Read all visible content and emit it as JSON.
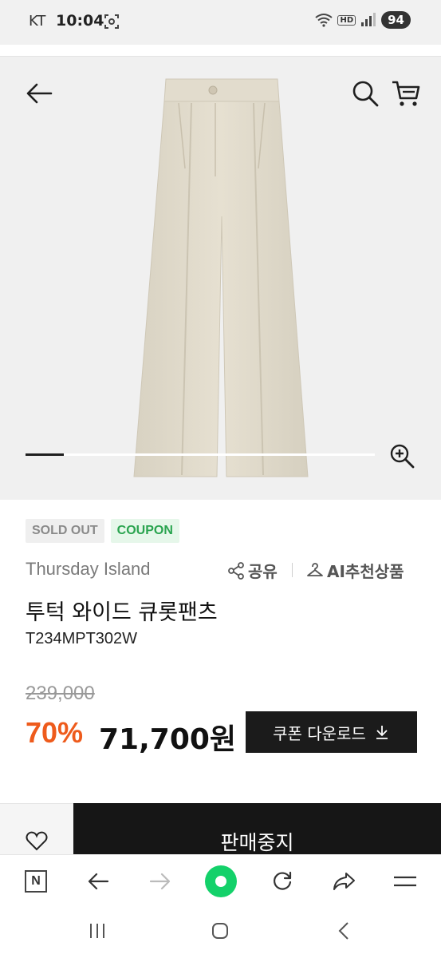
{
  "status_bar": {
    "carrier": "KT",
    "time": "10:04",
    "battery": "94"
  },
  "header": {
    "icons": [
      "back-arrow-icon",
      "search-icon",
      "cart-icon"
    ]
  },
  "gallery": {
    "progress_fraction": 0.11,
    "zoom_icon": "zoom-in-icon"
  },
  "badges": {
    "sold_out": "SOLD OUT",
    "coupon": "COUPON"
  },
  "product": {
    "brand": "Thursday Island",
    "share_label": "공유",
    "ai_label": "AI추천상품",
    "name": "투턱 와이드 큐롯팬츠",
    "code": "T234MPT302W",
    "original_price": "239,000",
    "discount": "70%",
    "price": "71,700원"
  },
  "coupon_button": {
    "label": "쿠폰 다운로드"
  },
  "action_bar": {
    "status_label": "판매중지"
  },
  "browser_toolbar": {
    "icons": [
      "naver-n-icon",
      "back-icon",
      "forward-icon",
      "home-icon",
      "refresh-icon",
      "share-icon",
      "menu-icon"
    ]
  },
  "colors": {
    "discount": "#ee5b1c",
    "coupon_badge": "#2aa44f",
    "home_green": "#14d16a"
  }
}
